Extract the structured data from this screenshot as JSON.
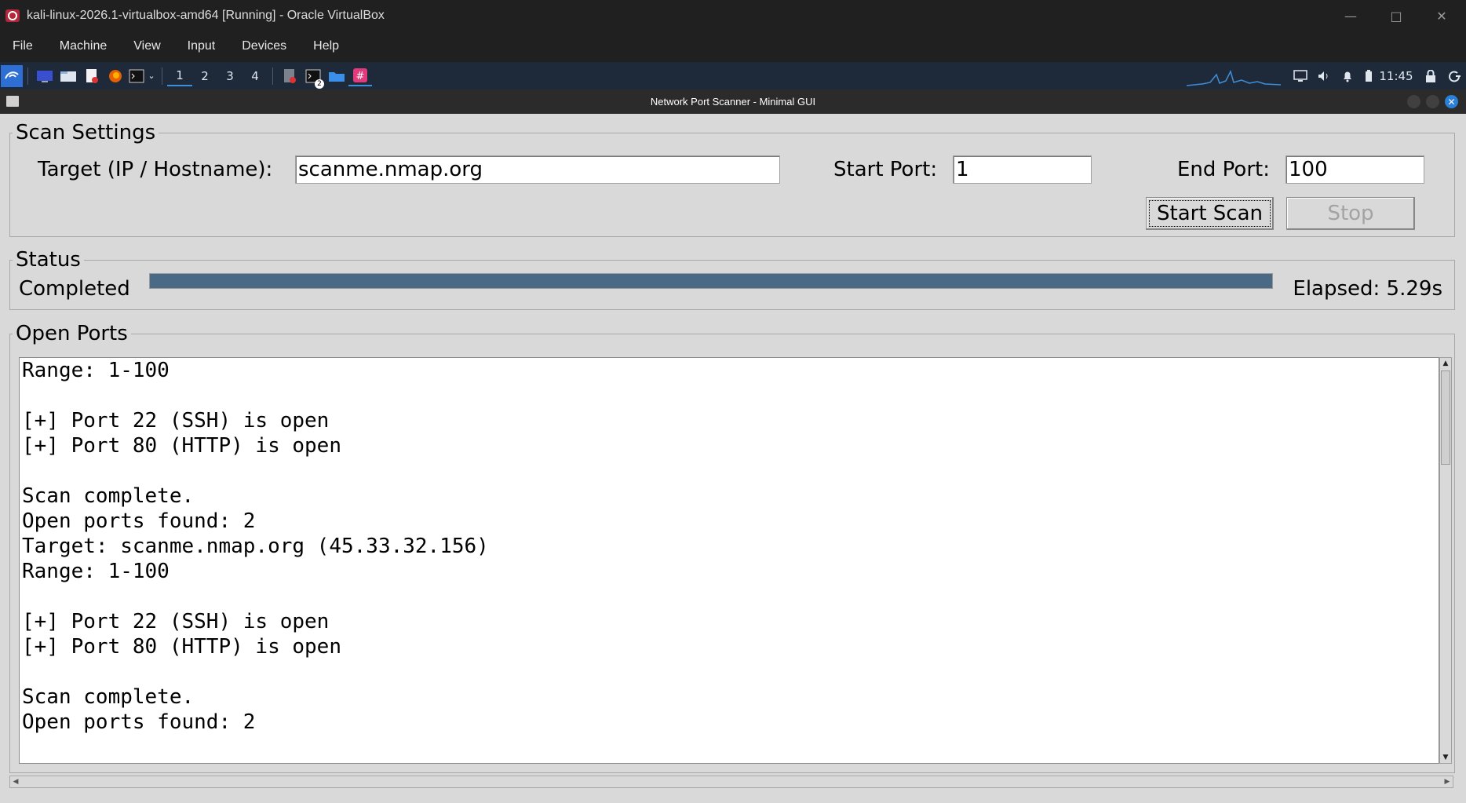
{
  "host": {
    "title": "kali-linux-2026.1-virtualbox-amd64 [Running] - Oracle VirtualBox",
    "menu": [
      "File",
      "Machine",
      "View",
      "Input",
      "Devices",
      "Help"
    ],
    "brand_color": "#b5263a"
  },
  "panel": {
    "workspaces": [
      "1",
      "2",
      "3",
      "4"
    ],
    "active_workspace": "1",
    "terminal_badge": "2",
    "clock": "11:45",
    "accent": "#3f8fd8"
  },
  "app": {
    "title": "Network Port Scanner - Minimal GUI",
    "settings": {
      "group_title": "Scan Settings",
      "target_label": "Target (IP / Hostname):",
      "target_value": "scanme.nmap.org",
      "start_port_label": "Start Port:",
      "start_port_value": "1",
      "end_port_label": "End Port:",
      "end_port_value": "100",
      "start_button": "Start Scan",
      "stop_button": "Stop"
    },
    "status": {
      "group_title": "Status",
      "state": "Completed",
      "progress_percent": 100,
      "elapsed": "Elapsed: 5.29s",
      "progress_color": "#4a6984"
    },
    "results": {
      "group_title": "Open Ports",
      "lines": [
        "Range: 1-100",
        "",
        "[+] Port 22 (SSH) is open",
        "[+] Port 80 (HTTP) is open",
        "",
        "Scan complete.",
        "Open ports found: 2",
        "Target: scanme.nmap.org (45.33.32.156)",
        "Range: 1-100",
        "",
        "[+] Port 22 (SSH) is open",
        "[+] Port 80 (HTTP) is open",
        "",
        "Scan complete.",
        "Open ports found: 2"
      ]
    }
  }
}
